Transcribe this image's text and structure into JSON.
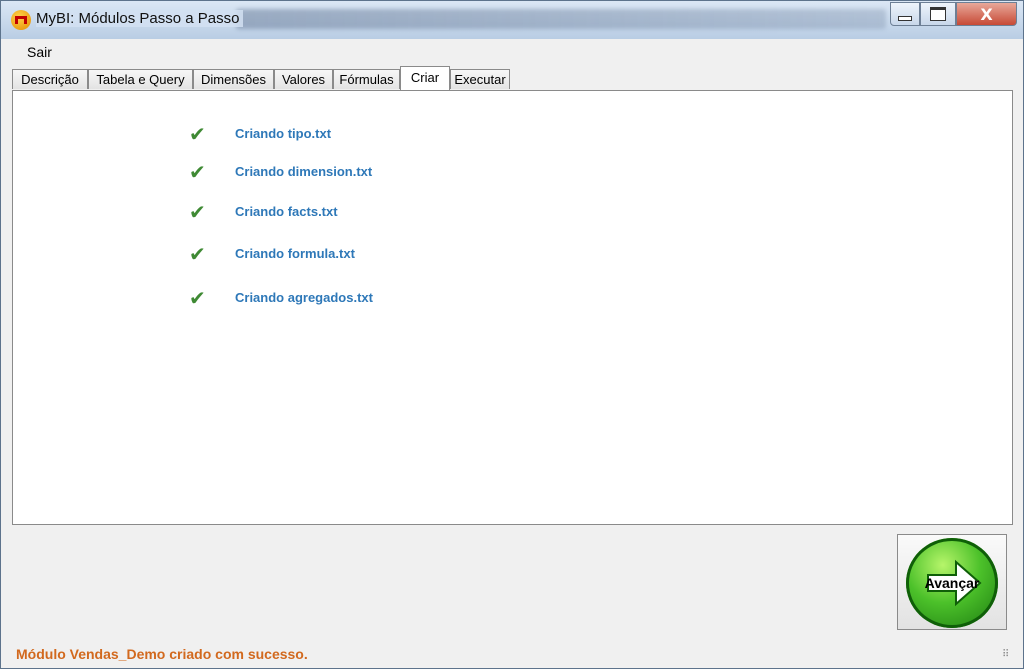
{
  "window": {
    "title": "MyBI: Módulos Passo a Passo",
    "close_symbol": "X",
    "app_icon": "mybi-logo-icon"
  },
  "menu": {
    "items": [
      {
        "label": "Sair"
      }
    ]
  },
  "tabs": [
    {
      "label": "Descrição",
      "active": false
    },
    {
      "label": "Tabela e Query",
      "active": false
    },
    {
      "label": "Dimensões",
      "active": false
    },
    {
      "label": "Valores",
      "active": false
    },
    {
      "label": "Fórmulas",
      "active": false
    },
    {
      "label": "Criar",
      "active": true
    },
    {
      "label": "Executar",
      "active": false
    }
  ],
  "tasks": [
    {
      "label": "Criando tipo.txt",
      "icon": "checkmark-icon",
      "status": "done"
    },
    {
      "label": "Criando dimension.txt",
      "icon": "checkmark-icon",
      "status": "done"
    },
    {
      "label": "Criando facts.txt",
      "icon": "checkmark-icon",
      "status": "done"
    },
    {
      "label": "Criando formula.txt",
      "icon": "checkmark-icon",
      "status": "done"
    },
    {
      "label": "Criando agregados.txt",
      "icon": "checkmark-icon",
      "status": "done"
    }
  ],
  "next_button": {
    "label": "Avançar",
    "icon": "arrow-right-icon"
  },
  "status": {
    "message": "Módulo Vendas_Demo criado com sucesso."
  },
  "colors": {
    "task_text": "#2e78b8",
    "status_text": "#d2691e",
    "check": "#3f8a34",
    "button_green": "#4cc12a"
  }
}
